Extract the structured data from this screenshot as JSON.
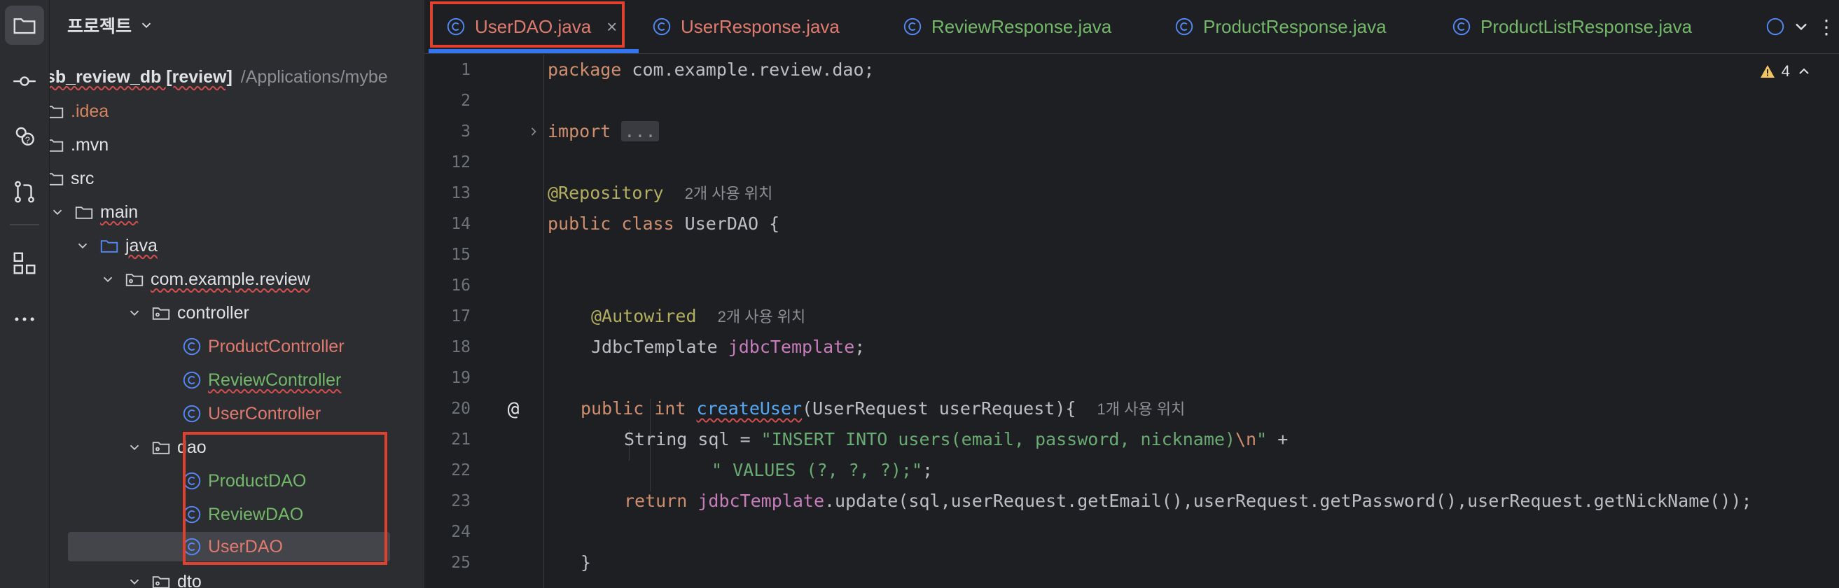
{
  "activity_bar": {
    "icons": [
      "project-folder-icon",
      "commit-icon",
      "ai-assistant-icon",
      "pull-requests-icon",
      "structure-icon",
      "more-icon"
    ]
  },
  "project_panel": {
    "header_title": "프로젝트",
    "root_name": "sb_review_db [review]",
    "root_path": "/Applications/mybe",
    "items": [
      {
        "label": ".idea",
        "kind": "folder"
      },
      {
        "label": ".mvn",
        "kind": "folder"
      },
      {
        "label": "src",
        "kind": "folder"
      },
      {
        "label": "main",
        "kind": "folder"
      },
      {
        "label": "java",
        "kind": "folder"
      },
      {
        "label": "com.example.review",
        "kind": "package"
      },
      {
        "label": "controller",
        "kind": "package"
      },
      {
        "label": "ProductController",
        "kind": "class"
      },
      {
        "label": "ReviewController",
        "kind": "class"
      },
      {
        "label": "UserController",
        "kind": "class"
      },
      {
        "label": "dao",
        "kind": "package"
      },
      {
        "label": "ProductDAO",
        "kind": "class"
      },
      {
        "label": "ReviewDAO",
        "kind": "class"
      },
      {
        "label": "UserDAO",
        "kind": "class"
      },
      {
        "label": "dto",
        "kind": "package"
      }
    ]
  },
  "tabs": [
    {
      "label": "UserDAO.java",
      "active": true
    },
    {
      "label": "UserResponse.java",
      "active": false
    },
    {
      "label": "ReviewResponse.java",
      "active": false
    },
    {
      "label": "ProductResponse.java",
      "active": false
    },
    {
      "label": "ProductListResponse.java",
      "active": false
    }
  ],
  "editor": {
    "warning_count": "4",
    "line_numbers": [
      "1",
      "2",
      "3",
      "12",
      "13",
      "14",
      "15",
      "16",
      "17",
      "18",
      "19",
      "20",
      "21",
      "22",
      "23",
      "24",
      "25"
    ],
    "usage_hint_2": "2개 사용 위치",
    "usage_hint_1": "1개 사용 위치",
    "code": {
      "l1_kw": "package",
      "l1_rest": " com.example.review.dao;",
      "l3_kw": "import",
      "l3_fold": "...",
      "l13_ann": "@Repository",
      "l14_kw": "public class",
      "l14_rest": " UserDAO {",
      "l17_ann": "@Autowired",
      "l18_type": "JdbcTemplate ",
      "l18_field": "jdbcTemplate",
      "l18_end": ";",
      "l20_kw": "public int",
      "l20_fn": "createUser",
      "l20_rest": "(UserRequest userRequest){",
      "l21_pre": "String sql = ",
      "l21_str": "\"INSERT INTO users(email, password, nickname)",
      "l21_esc": "\\n",
      "l21_str_end": "\"",
      "l21_plus": " +",
      "l22_str": "\" VALUES (?, ?, ?);\"",
      "l22_end": ";",
      "l23_kw": "return",
      "l23_field": "jdbcTemplate",
      "l23_rest": ".update(sql,userRequest.getEmail(),userRequest.getPassword(),userRequest.getNickName());",
      "l25": "}"
    }
  },
  "colors": {
    "accent": "#3574f0",
    "highlight_box": "#e0402e",
    "keyword": "#cf8e6d",
    "string": "#6aab73",
    "annotation": "#b3ae60"
  }
}
